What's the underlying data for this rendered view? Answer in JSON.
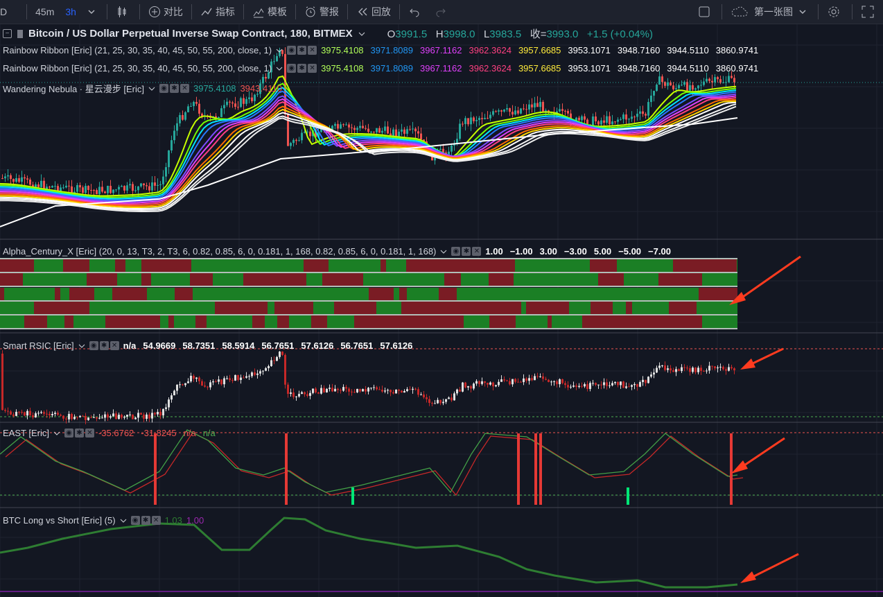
{
  "toolbar": {
    "left_glyph": "D",
    "intervals": [
      "45m",
      "3h"
    ],
    "active_interval": "3h",
    "compare": "对比",
    "indicators": "指标",
    "templates": "模板",
    "alerts": "警报",
    "replay": "回放",
    "layout_name": "第一张图"
  },
  "header": {
    "symbol": "Bitcoin / US Dollar Perpetual Inverse Swap Contract, 180, BITMEX",
    "o_label": "O",
    "o": "3991.5",
    "h_label": "H",
    "h": "3998.0",
    "l_label": "L",
    "l": "3983.5",
    "c_label": "收=",
    "c": "3993.0",
    "change": "+1.5 (+0.04%)"
  },
  "indicators": {
    "rainbow1": {
      "name": "Rainbow Ribbon [Eric] (21, 25, 30, 35, 40, 45, 50, 55, 200, close, 1)",
      "values": [
        "3975.4108",
        "3971.8089",
        "3967.1162",
        "3962.3624",
        "3957.6685",
        "3953.1071",
        "3948.7160",
        "3944.5110",
        "3860.9741"
      ],
      "colors": [
        "#b2ff59",
        "#2196f3",
        "#e040fb",
        "#ff4081",
        "#ffeb3b",
        "#ffffff",
        "#ffffff",
        "#ffffff",
        "#ffffff"
      ]
    },
    "rainbow2": {
      "name": "Rainbow Ribbon [Eric] (21, 25, 30, 35, 40, 45, 50, 55, 200, close, 1)",
      "values": [
        "3975.4108",
        "3971.8089",
        "3967.1162",
        "3962.3624",
        "3957.6685",
        "3953.1071",
        "3948.7160",
        "3944.5110",
        "3860.9741"
      ],
      "colors": [
        "#b2ff59",
        "#2196f3",
        "#e040fb",
        "#ff4081",
        "#ffeb3b",
        "#ffffff",
        "#ffffff",
        "#ffffff",
        "#ffffff"
      ]
    },
    "nebula": {
      "name": "Wandering Nebula · 星云漫步 [Eric]",
      "v1": "3975.4108",
      "v2": "3943.4110"
    },
    "alpha": {
      "name": "Alpha_Century_X [Eric] (20, 0, 13, T3, 2, T3, 6, 0.82, 0.85, 6, 0, 0.181, 1, 168, 0.82, 0.85, 6, 0, 0.181, 1, 168)",
      "values": [
        "1.00",
        "−1.00",
        "3.00",
        "−3.00",
        "5.00",
        "−5.00",
        "−7.00"
      ]
    },
    "rsic": {
      "name": "Smart RSIC [Eric]",
      "values": [
        "n/a",
        "54.9669",
        "58.7351",
        "58.5914",
        "56.7651",
        "57.6126",
        "56.7651",
        "57.6126"
      ]
    },
    "east": {
      "name": "EAST [Eric]",
      "values": [
        "-35.6762",
        "-31.8245",
        "n/a",
        "n/a"
      ]
    },
    "btcls": {
      "name": "BTC Long vs Short [Eric] (5)",
      "values": [
        "1.03",
        "1.00"
      ]
    }
  },
  "colors": {
    "up": "#26a69a",
    "down": "#ef5350",
    "bg": "#131722",
    "annotation": "#ff3b1f"
  }
}
